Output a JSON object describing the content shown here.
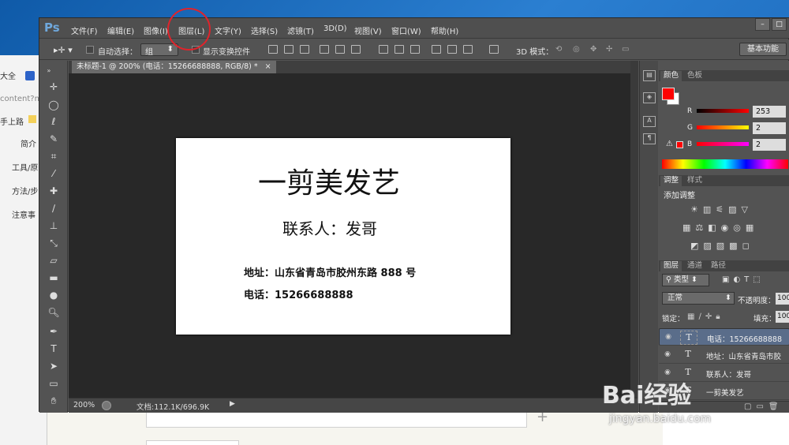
{
  "colors": {
    "accent": "#e0232b",
    "ps_bg": "#535353",
    "canvas_bg": "#282828",
    "fg_swatch": "#fd0202"
  },
  "browser": {
    "items": [
      "大全",
      "content?m",
      "手上路",
      "简介",
      "工具/原",
      "方法/步",
      "注意事"
    ]
  },
  "ps": {
    "logo": "Ps",
    "menus": [
      "文件(F)",
      "编辑(E)",
      "图像(I)",
      "图层(L)",
      "文字(Y)",
      "选择(S)",
      "滤镜(T)",
      "3D(D)",
      "视图(V)",
      "窗口(W)",
      "帮助(H)"
    ],
    "window_buttons": [
      "–",
      "□"
    ],
    "options": {
      "auto_select_label": "自动选择：",
      "auto_select_value": "组",
      "show_transform_label": "显示变换控件",
      "mode_3d_label": "3D 模式：",
      "workspace": "基本功能"
    },
    "tab_title": "未标题-1 @ 200% (电话：15266688888, RGB/8) *",
    "tab_close": "×",
    "document": {
      "title": "一剪美发艺",
      "contact": "联系人：发哥",
      "address": "地址：山东省青岛市胶州东路 888 号",
      "phone": "电话：15266688888"
    },
    "status": {
      "zoom": "200%",
      "doc_info": "文档:112.1K/696.9K"
    }
  },
  "panels": {
    "color_tabs": [
      "颜色",
      "色板"
    ],
    "rgb": [
      {
        "label": "R",
        "value": "253"
      },
      {
        "label": "G",
        "value": "2"
      },
      {
        "label": "B",
        "value": "2"
      }
    ],
    "adjust_tabs": [
      "调整",
      "样式"
    ],
    "adjust_title": "添加调整",
    "layers_tabs": [
      "图层",
      "通道",
      "路径"
    ],
    "filter_kind": "类型",
    "blend_mode": "正常",
    "opacity_label": "不透明度：",
    "opacity_value": "100",
    "lock_label": "锁定：",
    "fill_label": "填充：",
    "fill_value": "100",
    "layers": [
      {
        "name": "电话：15266688888",
        "selected": true
      },
      {
        "name": "地址：山东省青岛市胶",
        "selected": false
      },
      {
        "name": "联系人：发哥",
        "selected": false
      },
      {
        "name": "一剪美发艺",
        "selected": false
      }
    ],
    "layer_thumb": "T"
  },
  "watermark": {
    "brand": "Bai经验",
    "url": "jingyan.baidu.com"
  }
}
